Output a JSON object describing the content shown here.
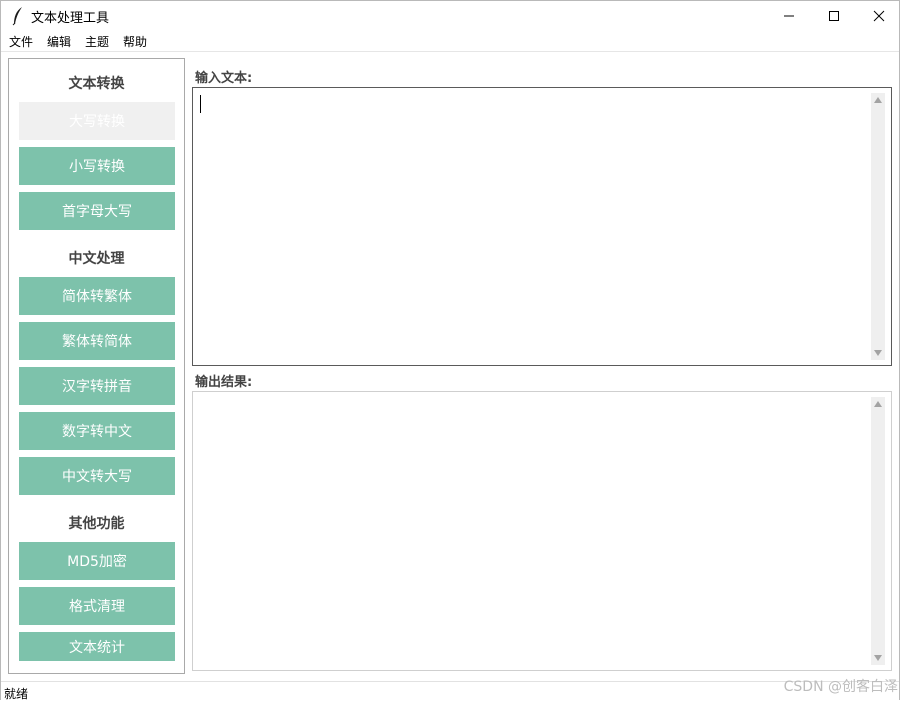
{
  "window": {
    "title": "文本处理工具"
  },
  "menu": [
    "文件",
    "编辑",
    "主题",
    "帮助"
  ],
  "sidebar": {
    "sections": [
      {
        "title": "文本转换",
        "buttons": [
          "大写转换",
          "小写转换",
          "首字母大写"
        ]
      },
      {
        "title": "中文处理",
        "buttons": [
          "简体转繁体",
          "繁体转简体",
          "汉字转拼音",
          "数字转中文",
          "中文转大写"
        ]
      },
      {
        "title": "其他功能",
        "buttons": [
          "MD5加密",
          "格式清理",
          "文本统计"
        ]
      }
    ]
  },
  "input": {
    "label": "输入文本:",
    "value": ""
  },
  "output": {
    "label": "输出结果:",
    "value": ""
  },
  "status": {
    "text": "就绪"
  },
  "watermark": "CSDN @创客白泽",
  "colors": {
    "button": "#7dc2ab",
    "button_disabled": "#f0f0f0",
    "window_border": "#b9b9b9"
  },
  "icons": {
    "app": "feather-icon",
    "minimize": "minimize-icon",
    "maximize": "maximize-icon",
    "close": "close-icon"
  }
}
